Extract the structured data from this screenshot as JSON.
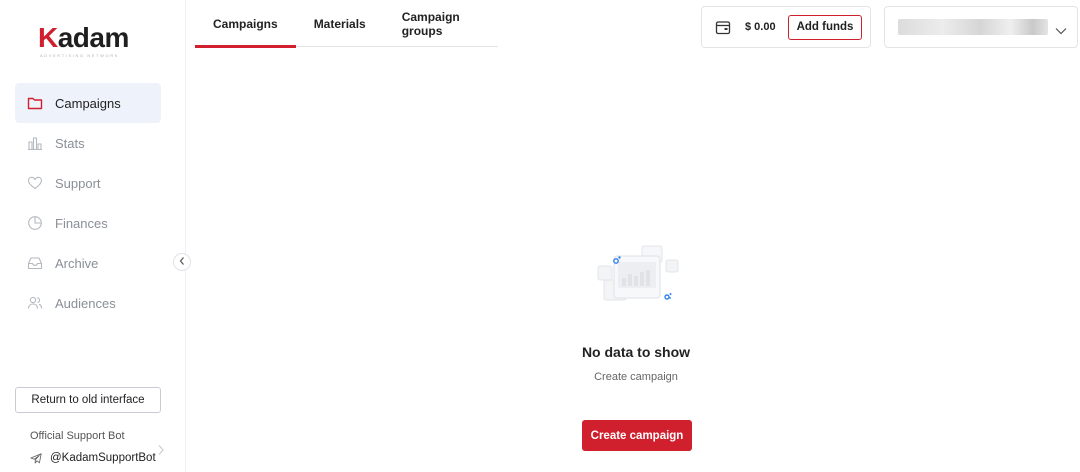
{
  "brand": {
    "logo_text": "adam",
    "logo_letter": "K",
    "tagline": "ADVERTISING NETWORK",
    "accent": "#d0202e"
  },
  "sidebar": {
    "items": [
      {
        "label": "Campaigns",
        "icon": "folder-icon",
        "active": true
      },
      {
        "label": "Stats",
        "icon": "bar-chart-icon",
        "active": false
      },
      {
        "label": "Support",
        "icon": "heart-icon",
        "active": false
      },
      {
        "label": "Finances",
        "icon": "pie-chart-icon",
        "active": false
      },
      {
        "label": "Archive",
        "icon": "inbox-icon",
        "active": false
      },
      {
        "label": "Audiences",
        "icon": "users-icon",
        "active": false
      }
    ],
    "old_interface_label": "Return to old interface",
    "support_bot_title": "Official Support Bot",
    "support_bot_handle": "@KadamSupportBot"
  },
  "tabs": [
    {
      "label": "Campaigns",
      "active": true
    },
    {
      "label": "Materials",
      "active": false
    },
    {
      "label": "Campaign groups",
      "active": false
    }
  ],
  "wallet": {
    "balance": "$ 0.00",
    "add_funds_label": "Add funds"
  },
  "empty_state": {
    "title": "No data to show",
    "subtitle": "Create campaign",
    "button_label": "Create campaign"
  }
}
